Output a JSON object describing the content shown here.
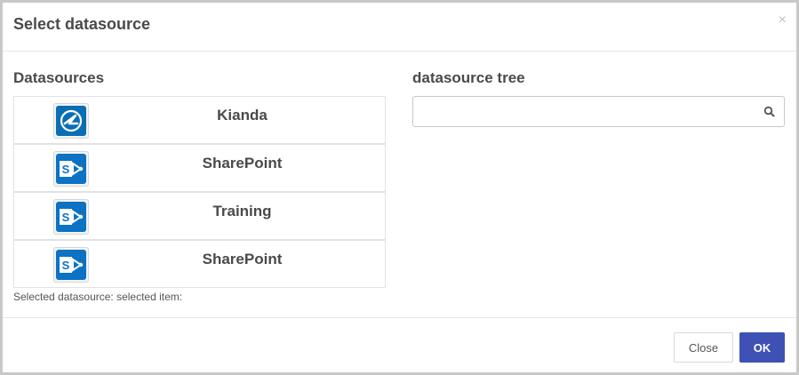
{
  "dialog": {
    "title": "Select datasource",
    "close_symbol": "×"
  },
  "datasources": {
    "heading": "Datasources",
    "items": [
      {
        "label": "Kianda",
        "icon": "kianda-logo-icon"
      },
      {
        "label": "SharePoint",
        "icon": "sharepoint-icon"
      },
      {
        "label": "Training",
        "icon": "sharepoint-icon"
      },
      {
        "label": "SharePoint",
        "icon": "sharepoint-icon"
      }
    ],
    "selected_text": "Selected datasource: selected item:"
  },
  "tree": {
    "heading": "datasource tree",
    "search_value": "",
    "search_icon": "search-icon"
  },
  "footer": {
    "close_label": "Close",
    "ok_label": "OK"
  },
  "colors": {
    "primary": "#3f51b5",
    "kianda_blue": "#0b6eb5",
    "sharepoint_blue": "#0b72c4"
  }
}
